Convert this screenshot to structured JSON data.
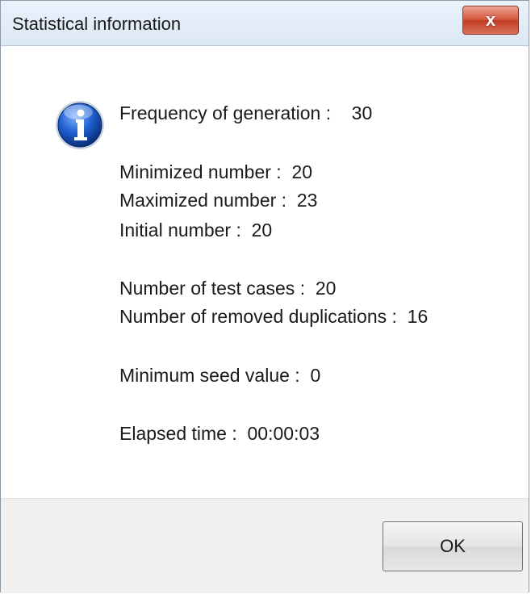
{
  "window": {
    "title": "Statistical information",
    "close_label": "x"
  },
  "stats": {
    "frequency": "Frequency of generation :    30",
    "minimized": "Minimized number :  20",
    "maximized": "Maximized number :  23",
    "initial": "Initial number :  20",
    "test_cases": "Number of test cases :  20",
    "removed_duplications": "Number of removed duplications :  16",
    "min_seed": "Minimum seed value :  0",
    "elapsed": "Elapsed time :  00:00:03"
  },
  "footer": {
    "ok_label": "OK"
  },
  "icons": {
    "info": "information-icon",
    "close": "close-icon"
  }
}
